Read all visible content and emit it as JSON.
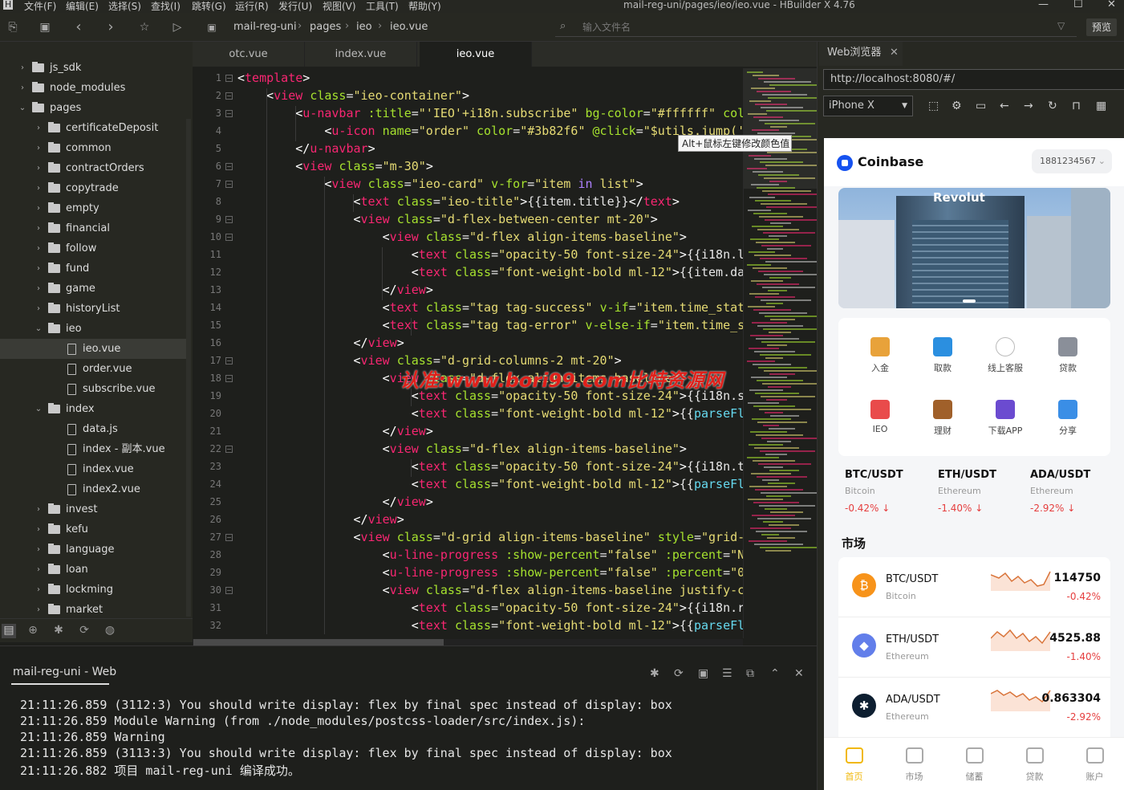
{
  "menubar": {
    "items": [
      "文件(F)",
      "编辑(E)",
      "选择(S)",
      "查找(I)",
      "跳转(G)",
      "运行(R)",
      "发行(U)",
      "视图(V)",
      "工具(T)",
      "帮助(Y)"
    ],
    "window_title": "mail-reg-uni/pages/ieo/ieo.vue - HBuilder X 4.76"
  },
  "toolbar": {
    "breadcrumb": [
      "mail-reg-uni",
      "pages",
      "ieo",
      "ieo.vue"
    ],
    "file_search_placeholder": "输入文件名",
    "preview_label": "预览"
  },
  "sidebar": {
    "items": [
      {
        "label": "js_sdk",
        "type": "folder",
        "expanded": false,
        "depth": 0
      },
      {
        "label": "node_modules",
        "type": "folder",
        "expanded": false,
        "depth": 0
      },
      {
        "label": "pages",
        "type": "folder",
        "expanded": true,
        "depth": 0
      },
      {
        "label": "certificateDeposit",
        "type": "folder",
        "expanded": false,
        "depth": 1
      },
      {
        "label": "common",
        "type": "folder",
        "expanded": false,
        "depth": 1
      },
      {
        "label": "contractOrders",
        "type": "folder",
        "expanded": false,
        "depth": 1
      },
      {
        "label": "copytrade",
        "type": "folder",
        "expanded": false,
        "depth": 1
      },
      {
        "label": "empty",
        "type": "folder",
        "expanded": false,
        "depth": 1
      },
      {
        "label": "financial",
        "type": "folder",
        "expanded": false,
        "depth": 1
      },
      {
        "label": "follow",
        "type": "folder",
        "expanded": false,
        "depth": 1
      },
      {
        "label": "fund",
        "type": "folder",
        "expanded": false,
        "depth": 1
      },
      {
        "label": "game",
        "type": "folder",
        "expanded": false,
        "depth": 1
      },
      {
        "label": "historyList",
        "type": "folder",
        "expanded": false,
        "depth": 1
      },
      {
        "label": "ieo",
        "type": "folder",
        "expanded": true,
        "depth": 1
      },
      {
        "label": "ieo.vue",
        "type": "file",
        "selected": true,
        "depth": 2
      },
      {
        "label": "order.vue",
        "type": "file",
        "depth": 2
      },
      {
        "label": "subscribe.vue",
        "type": "file",
        "depth": 2
      },
      {
        "label": "index",
        "type": "folder",
        "expanded": true,
        "depth": 1
      },
      {
        "label": "data.js",
        "type": "file",
        "depth": 2
      },
      {
        "label": "index - 副本.vue",
        "type": "file",
        "depth": 2
      },
      {
        "label": "index.vue",
        "type": "file",
        "depth": 2
      },
      {
        "label": "index2.vue",
        "type": "file",
        "depth": 2
      },
      {
        "label": "invest",
        "type": "folder",
        "expanded": false,
        "depth": 1
      },
      {
        "label": "kefu",
        "type": "folder",
        "expanded": false,
        "depth": 1
      },
      {
        "label": "language",
        "type": "folder",
        "expanded": false,
        "depth": 1
      },
      {
        "label": "loan",
        "type": "folder",
        "expanded": false,
        "depth": 1
      },
      {
        "label": "lockming",
        "type": "folder",
        "expanded": false,
        "depth": 1
      },
      {
        "label": "market",
        "type": "folder",
        "expanded": false,
        "depth": 1
      }
    ]
  },
  "editor": {
    "tabs": [
      {
        "label": "otc.vue",
        "active": false
      },
      {
        "label": "index.vue",
        "active": false
      },
      {
        "label": "ieo.vue",
        "active": true
      }
    ],
    "tooltip": "Alt+鼠标左键修改颜色值",
    "watermark": "认准:www.bori99.com比特资源网",
    "lines": [
      {
        "n": "1",
        "fold": true,
        "html": "<span class='pu'>&lt;</span><span class='tg'>template</span><span class='pu'>&gt;</span>"
      },
      {
        "n": "2",
        "fold": true,
        "html": "    <span class='pu'>&lt;</span><span class='tg'>view</span> <span class='at'>class</span>=<span class='st'>\"ieo-container\"</span><span class='pu'>&gt;</span>"
      },
      {
        "n": "3",
        "fold": true,
        "html": "        <span class='pu'>&lt;</span><span class='tg'>u-navbar</span> <span class='at'>:title</span>=<span class='st'>\"'IEO'+i18n.subscribe\"</span> <span class='at'>bg-color</span>=<span class='st'>\"#ffffff\"</span> <span class='at'>col</span>"
      },
      {
        "n": "4",
        "fold": false,
        "html": "            <span class='pu'>&lt;</span><span class='tg'>u-icon</span> <span class='at'>name</span>=<span class='st'>\"order\"</span> <span class='at'>color</span>=<span class='st'>\"#3b82f6\"</span> <span class='at'>@click</span>=<span class='st'>\"$utils.jump('</span>"
      },
      {
        "n": "5",
        "fold": false,
        "html": "        <span class='pu'>&lt;/</span><span class='tg'>u-navbar</span><span class='pu'>&gt;</span>"
      },
      {
        "n": "6",
        "fold": true,
        "html": "        <span class='pu'>&lt;</span><span class='tg'>view</span> <span class='at'>class</span>=<span class='st'>\"m-30\"</span><span class='pu'>&gt;</span>"
      },
      {
        "n": "7",
        "fold": true,
        "html": "            <span class='pu'>&lt;</span><span class='tg'>view</span> <span class='at'>class</span>=<span class='st'>\"ieo-card\"</span> <span class='at'>v-for</span>=<span class='st'>\"item <span class='kw'>in</span> list\"</span><span class='pu'>&gt;</span>"
      },
      {
        "n": "8",
        "fold": false,
        "html": "                <span class='pu'>&lt;</span><span class='tg'>text</span> <span class='at'>class</span>=<span class='st'>\"ieo-title\"</span><span class='pu'>&gt;</span>{{item.title}}<span class='pu'>&lt;/</span><span class='tg'>text</span><span class='pu'>&gt;</span>"
      },
      {
        "n": "9",
        "fold": true,
        "html": "                <span class='pu'>&lt;</span><span class='tg'>view</span> <span class='at'>class</span>=<span class='st'>\"d-flex-between-center mt-20\"</span><span class='pu'>&gt;</span>"
      },
      {
        "n": "10",
        "fold": true,
        "html": "                    <span class='pu'>&lt;</span><span class='tg'>view</span> <span class='at'>class</span>=<span class='st'>\"d-flex align-items-baseline\"</span><span class='pu'>&gt;</span>"
      },
      {
        "n": "11",
        "fold": false,
        "html": "                        <span class='pu'>&lt;</span><span class='tg'>text</span> <span class='at'>class</span>=<span class='st'>\"opacity-50 font-size-24\"</span><span class='pu'>&gt;</span>{{i18n.l"
      },
      {
        "n": "12",
        "fold": false,
        "html": "                        <span class='pu'>&lt;</span><span class='tg'>text</span> <span class='at'>class</span>=<span class='st'>\"font-weight-bold ml-12\"</span><span class='pu'>&gt;</span>{{item.da"
      },
      {
        "n": "13",
        "fold": false,
        "html": "                    <span class='pu'>&lt;/</span><span class='tg'>view</span><span class='pu'>&gt;</span>"
      },
      {
        "n": "14",
        "fold": false,
        "html": "                    <span class='pu'>&lt;</span><span class='tg'>text</span> <span class='at'>class</span>=<span class='st'>\"tag tag-success\"</span> <span class='at'>v-if</span>=<span class='st'>\"item.time_stat</span>"
      },
      {
        "n": "15",
        "fold": false,
        "html": "                    <span class='pu'>&lt;</span><span class='tg'>text</span> <span class='at'>class</span>=<span class='st'>\"tag tag-error\"</span> <span class='at'>v-else-if</span>=<span class='st'>\"item.time_s</span>"
      },
      {
        "n": "16",
        "fold": false,
        "html": "                <span class='pu'>&lt;/</span><span class='tg'>view</span><span class='pu'>&gt;</span>"
      },
      {
        "n": "17",
        "fold": true,
        "html": "                <span class='pu'>&lt;</span><span class='tg'>view</span> <span class='at'>class</span>=<span class='st'>\"d-grid-columns-2 mt-20\"</span><span class='pu'>&gt;</span>"
      },
      {
        "n": "18",
        "fold": true,
        "html": "                    <span class='pu'>&lt;</span><span class='tg'>view</span> <span class='at'>class</span>=<span class='st'>\"d-flex align-items-baseline\"</span><span class='pu'>&gt;</span>"
      },
      {
        "n": "19",
        "fold": false,
        "html": "                        <span class='pu'>&lt;</span><span class='tg'>text</span> <span class='at'>class</span>=<span class='st'>\"opacity-50 font-size-24\"</span><span class='pu'>&gt;</span>{{i18n.s"
      },
      {
        "n": "20",
        "fold": false,
        "html": "                        <span class='pu'>&lt;</span><span class='tg'>text</span> <span class='at'>class</span>=<span class='st'>\"font-weight-bold ml-12\"</span><span class='pu'>&gt;</span>{{<span class='cy'>parseFl</span>"
      },
      {
        "n": "21",
        "fold": false,
        "html": "                    <span class='pu'>&lt;/</span><span class='tg'>view</span><span class='pu'>&gt;</span>"
      },
      {
        "n": "22",
        "fold": true,
        "html": "                    <span class='pu'>&lt;</span><span class='tg'>view</span> <span class='at'>class</span>=<span class='st'>\"d-flex align-items-baseline\"</span><span class='pu'>&gt;</span>"
      },
      {
        "n": "23",
        "fold": false,
        "html": "                        <span class='pu'>&lt;</span><span class='tg'>text</span> <span class='at'>class</span>=<span class='st'>\"opacity-50 font-size-24\"</span><span class='pu'>&gt;</span>{{i18n.t"
      },
      {
        "n": "24",
        "fold": false,
        "html": "                        <span class='pu'>&lt;</span><span class='tg'>text</span> <span class='at'>class</span>=<span class='st'>\"font-weight-bold ml-12\"</span><span class='pu'>&gt;</span>{{<span class='cy'>parseFl</span>"
      },
      {
        "n": "25",
        "fold": false,
        "html": "                    <span class='pu'>&lt;/</span><span class='tg'>view</span><span class='pu'>&gt;</span>"
      },
      {
        "n": "26",
        "fold": false,
        "html": "                <span class='pu'>&lt;/</span><span class='tg'>view</span><span class='pu'>&gt;</span>"
      },
      {
        "n": "27",
        "fold": true,
        "html": "                <span class='pu'>&lt;</span><span class='tg'>view</span> <span class='at'>class</span>=<span class='st'>\"d-grid align-items-baseline\"</span> <span class='at'>style</span>=<span class='st'>\"grid-</span>"
      },
      {
        "n": "28",
        "fold": false,
        "html": "                    <span class='pu'>&lt;</span><span class='tg'>u-line-progress</span> <span class='at'>:show-percent</span>=<span class='st'>\"false\"</span> <span class='at'>:percent</span>=<span class='st'>\"N</span>"
      },
      {
        "n": "29",
        "fold": false,
        "html": "                    <span class='pu'>&lt;</span><span class='tg'>u-line-progress</span> <span class='at'>:show-percent</span>=<span class='st'>\"false\"</span> <span class='at'>:percent</span>=<span class='st'>\"0</span>"
      },
      {
        "n": "30",
        "fold": true,
        "html": "                    <span class='pu'>&lt;</span><span class='tg'>view</span> <span class='at'>class</span>=<span class='st'>\"d-flex align-items-baseline justify-c</span>"
      },
      {
        "n": "31",
        "fold": false,
        "html": "                        <span class='pu'>&lt;</span><span class='tg'>text</span> <span class='at'>class</span>=<span class='st'>\"opacity-50 font-size-24\"</span><span class='pu'>&gt;</span>{{i18n.r"
      },
      {
        "n": "32",
        "fold": false,
        "html": "                        <span class='pu'>&lt;</span><span class='tg'>text</span> <span class='at'>class</span>=<span class='st'>\"font-weight-bold ml-12\"</span><span class='pu'>&gt;</span>{{<span class='cy'>parseFl</span>"
      }
    ]
  },
  "console": {
    "title": "mail-reg-uni - Web",
    "lines": [
      "21:11:26.859 (3112:3) You should write display: flex by final spec instead of display: box",
      "21:11:26.859 Module Warning (from ./node_modules/postcss-loader/src/index.js):",
      "21:11:26.859 Warning",
      "21:11:26.859 (3113:3) You should write display: flex by final spec instead of display: box",
      "21:11:26.882 项目 mail-reg-uni 编译成功。"
    ]
  },
  "browser": {
    "tab_label": "Web浏览器",
    "url": "http://localhost:8080/#/",
    "device": "iPhone X",
    "app": {
      "brand": "Coinbase",
      "phone": "1881234567",
      "banner_text": "Revolut",
      "quick_actions": [
        {
          "label": "入金",
          "icon": "money-bag-icon",
          "color": "#e8a23a"
        },
        {
          "label": "取款",
          "icon": "card-icon",
          "color": "#2b8fe0"
        },
        {
          "label": "线上客服",
          "icon": "chat-bubble-icon",
          "color": "#dddddd"
        },
        {
          "label": "贷款",
          "icon": "bank-icon",
          "color": "#8a8f99"
        },
        {
          "label": "IEO",
          "icon": "rocket-icon",
          "color": "#e94b4b"
        },
        {
          "label": "理财",
          "icon": "briefcase-icon",
          "color": "#a0602a"
        },
        {
          "label": "下载APP",
          "icon": "phone-app-icon",
          "color": "#6b4bd0"
        },
        {
          "label": "分享",
          "icon": "share-box-icon",
          "color": "#3a8ee6"
        }
      ],
      "tickers": [
        {
          "pair": "BTC/USDT",
          "name": "Bitcoin",
          "change": "-0.42% ↓"
        },
        {
          "pair": "ETH/USDT",
          "name": "Ethereum",
          "change": "-1.40% ↓"
        },
        {
          "pair": "ADA/USDT",
          "name": "Ethereum",
          "change": "-2.92% ↓"
        }
      ],
      "market_title": "市场",
      "markets": [
        {
          "pair": "BTC/USDT",
          "name": "Bitcoin",
          "price": "114750",
          "change": "-0.42%",
          "coin_color": "#f7931a",
          "coin_symbol": "₿"
        },
        {
          "pair": "ETH/USDT",
          "name": "Ethereum",
          "price": "4525.88",
          "change": "-1.40%",
          "coin_color": "#627eea",
          "coin_symbol": "◆"
        },
        {
          "pair": "ADA/USDT",
          "name": "Ethereum",
          "price": "0.863304",
          "change": "-2.92%",
          "coin_color": "#0d1e30",
          "coin_symbol": "✱"
        }
      ],
      "tabbar": [
        {
          "label": "首页",
          "active": true
        },
        {
          "label": "市场",
          "active": false
        },
        {
          "label": "储蓄",
          "active": false
        },
        {
          "label": "贷款",
          "active": false
        },
        {
          "label": "账户",
          "active": false
        }
      ]
    }
  }
}
